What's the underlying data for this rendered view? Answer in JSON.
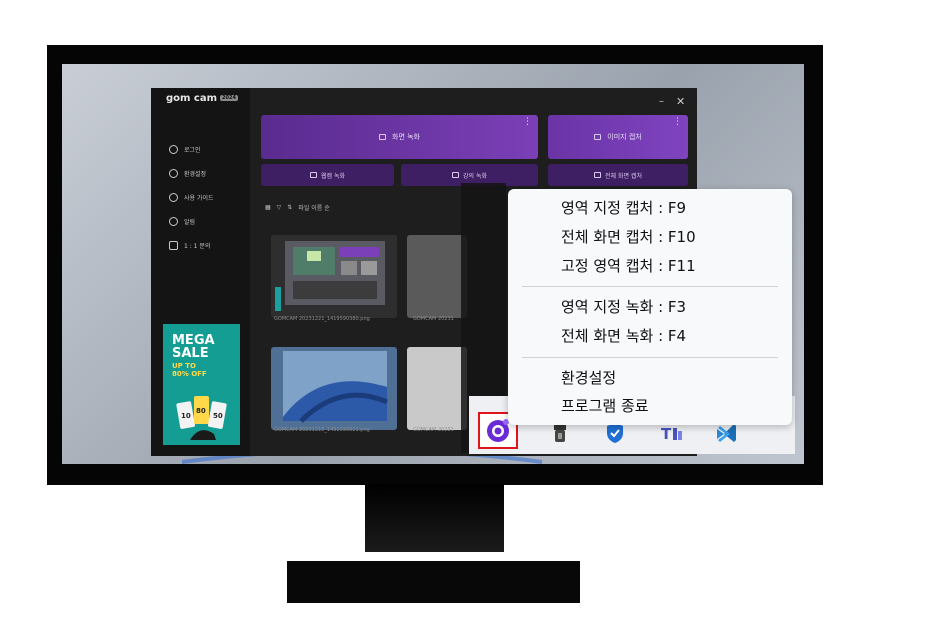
{
  "app": {
    "logo_text": "gom cam",
    "logo_badge": "2024",
    "window_controls": {
      "minimize": "–",
      "close": "✕"
    }
  },
  "sidebar": {
    "items": [
      {
        "label": "로그인",
        "icon": "user-icon"
      },
      {
        "label": "환경설정",
        "icon": "gear-icon"
      },
      {
        "label": "사용 가이드",
        "icon": "info-icon"
      },
      {
        "label": "알림",
        "icon": "bell-icon"
      },
      {
        "label": "1 : 1 문의",
        "icon": "chat-icon"
      }
    ],
    "ad": {
      "line1": "MEGA",
      "line2": "SALE",
      "line3": "UP TO",
      "line4": "80% OFF",
      "coupons": [
        "10",
        "80",
        "50"
      ]
    }
  },
  "main": {
    "screen_record_label": "화면 녹화",
    "image_capture_label": "이미지 캡처",
    "webcam_record_label": "웹캠 녹화",
    "lecture_record_label": "강의 녹화",
    "fullscreen_capture_label": "전체 화면 캡처",
    "more_glyph": "⋮",
    "sort_label": "파일 이름 순",
    "files": [
      {
        "name": "GOMCAM 20231221_1419590380.png"
      },
      {
        "name": "GOMCAM 20231"
      },
      {
        "name": "GOMCAM 20231215_1431030921.png"
      },
      {
        "name": "GOMCAM 20231"
      }
    ]
  },
  "context_menu": {
    "group1": [
      "영역 지정 캡처 : F9",
      "전체 화면 캡처 : F10",
      "고정 영역 캡처 : F11"
    ],
    "group2": [
      "영역 지정 녹화 : F3",
      "전체 화면 녹화 : F4"
    ],
    "group3": [
      "환경설정",
      "프로그램 종료"
    ]
  },
  "tray": {
    "icons": [
      "gomcam-tray-icon",
      "usb-device-icon",
      "defender-shield-icon",
      "teams-icon",
      "vscode-icon"
    ],
    "highlight_color": "#e0141c"
  },
  "colors": {
    "accent_purple": "#7b3fb7",
    "ad_teal": "#149d92"
  }
}
